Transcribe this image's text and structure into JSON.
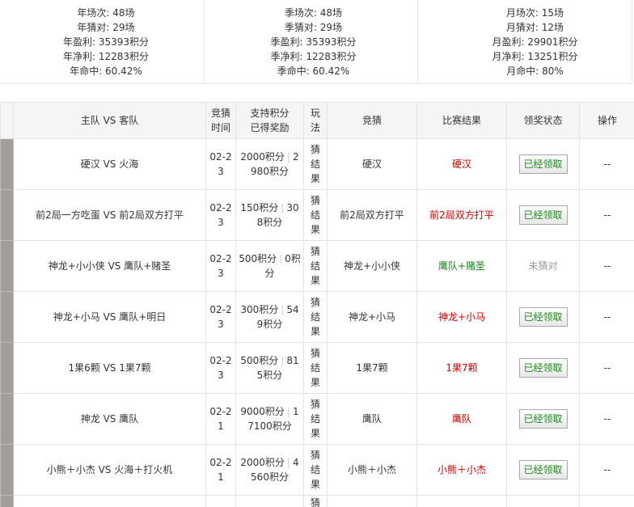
{
  "stats": {
    "year": {
      "games": "年场次: 48场",
      "correct": "年猜对: 29场",
      "profit": "年盈利: 35393积分",
      "net": "年净利: 12283积分",
      "rate": "年命中: 60.42%"
    },
    "season": {
      "games": "季场次: 48场",
      "correct": "季猜对: 29场",
      "profit": "季盈利: 35393积分",
      "net": "季净利: 12283积分",
      "rate": "季命中: 60.42%"
    },
    "month": {
      "games": "月场次: 15场",
      "correct": "月猜对: 12场",
      "profit": "月盈利: 29901积分",
      "net": "月净利: 13251积分",
      "rate": "月命中: 80%"
    }
  },
  "table": {
    "headers": {
      "match": "主队 VS 客队",
      "time": "竞猜时间",
      "stake_line1": "支持积分",
      "stake_line2": "已得奖励",
      "play": "玩法",
      "pick": "竞猜",
      "result": "比赛结果",
      "claim": "领奖状态",
      "action": "操作"
    },
    "sep": "|",
    "rows": [
      {
        "match": "硬汉 VS 火海",
        "time": "02-23",
        "stake": "2000积分",
        "reward": "2980积分",
        "play": "猜结果",
        "pick": "硬汉",
        "result": "硬汉",
        "claim": "已经领取",
        "action": "--"
      },
      {
        "match": "前2局一方吃蛋 VS 前2局双方打平",
        "time": "02-23",
        "stake": "150积分",
        "reward": "308积分",
        "play": "猜结果",
        "pick": "前2局双方打平",
        "result": "前2局双方打平",
        "claim": "已经领取",
        "action": "--"
      },
      {
        "match": "神龙+小小侠 VS 鹰队+赌圣",
        "time": "02-23",
        "stake": "500积分",
        "reward": "0积分",
        "play": "猜结果",
        "pick": "神龙+小小侠",
        "result": "鹰队+赌圣",
        "claim": "未猜对",
        "action": "--"
      },
      {
        "match": "神龙+小马 VS 鹰队+明日",
        "time": "02-23",
        "stake": "300积分",
        "reward": "549积分",
        "play": "猜结果",
        "pick": "神龙+小马",
        "result": "神龙+小马",
        "claim": "已经领取",
        "action": "--"
      },
      {
        "match": "1果6颗 VS 1果7颗",
        "time": "02-23",
        "stake": "500积分",
        "reward": "815积分",
        "play": "猜结果",
        "pick": "1果7颗",
        "result": "1果7颗",
        "claim": "已经领取",
        "action": "--"
      },
      {
        "match": "神龙 VS 鹰队",
        "time": "02-21",
        "stake": "9000积分",
        "reward": "17100积分",
        "play": "猜结果",
        "pick": "鹰队",
        "result": "鹰队",
        "claim": "已经领取",
        "action": "--"
      },
      {
        "match": "小熊＋小杰 VS 火海＋打火机",
        "time": "02-21",
        "stake": "2000积分",
        "reward": "4560积分",
        "play": "猜结果",
        "pick": "小熊＋小杰",
        "result": "小熊＋小杰",
        "claim": "已经领取",
        "action": "--"
      },
      {
        "play": "猜"
      }
    ]
  },
  "colors": {
    "win_result": "#cc0000",
    "lose_result": "#1a7f1a",
    "claimed_text": "#1a8a1a",
    "not_claimed": "#999999"
  }
}
